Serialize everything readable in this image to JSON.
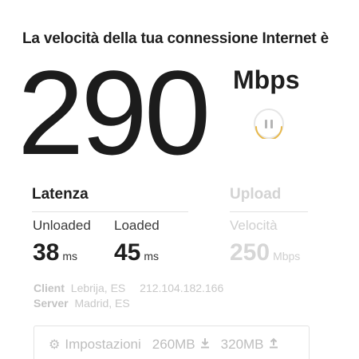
{
  "headline": "La velocità della tua connessione Internet è",
  "speed": {
    "value": "290",
    "unit": "Mbps"
  },
  "pause_button": {
    "icon": "pause-icon",
    "accent_color": "#e8b84a"
  },
  "latency": {
    "title": "Latenza",
    "unloaded_label": "Unloaded",
    "unloaded_value": "38",
    "unloaded_unit": "ms",
    "loaded_label": "Loaded",
    "loaded_value": "45",
    "loaded_unit": "ms"
  },
  "upload": {
    "title": "Upload",
    "speed_label": "Velocità",
    "speed_value": "250",
    "speed_unit": "Mbps"
  },
  "client": {
    "label": "Client",
    "location": "Lebrija, ES",
    "ip": "212.104.182.166"
  },
  "server": {
    "label": "Server",
    "location": "Madrid, ES"
  },
  "settings": {
    "icon": "gear-icon",
    "label": "Impostazioni",
    "download_size": "260MB",
    "upload_size": "320MB"
  }
}
